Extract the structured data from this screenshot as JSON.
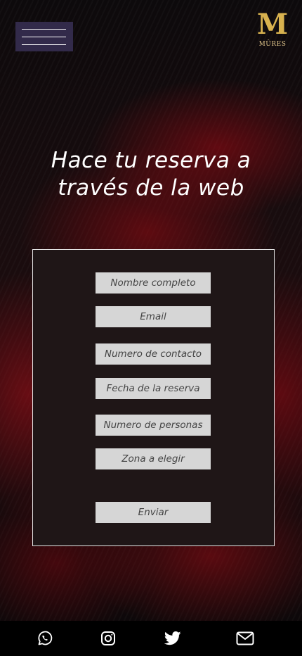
{
  "header": {
    "menu_label": "menu",
    "logo_mark": "M",
    "logo_text": "MÛRES"
  },
  "hero": {
    "title": "Hace tu reserva a través de la web"
  },
  "form": {
    "fields": [
      {
        "placeholder": "Nombre completo"
      },
      {
        "placeholder": "Email"
      },
      {
        "placeholder": "Numero de contacto"
      },
      {
        "placeholder": "Fecha de la reserva"
      },
      {
        "placeholder": "Numero de personas"
      },
      {
        "placeholder": "Zona a elegir"
      }
    ],
    "submit_label": "Enviar"
  },
  "footer": {
    "icons": [
      "whatsapp-icon",
      "instagram-icon",
      "twitter-icon",
      "email-icon"
    ]
  },
  "colors": {
    "menu_bg": "#322a4a",
    "form_bg": "#1f1617",
    "field_bg": "#d6d6d6",
    "logo_gold": "#d8b24f"
  }
}
